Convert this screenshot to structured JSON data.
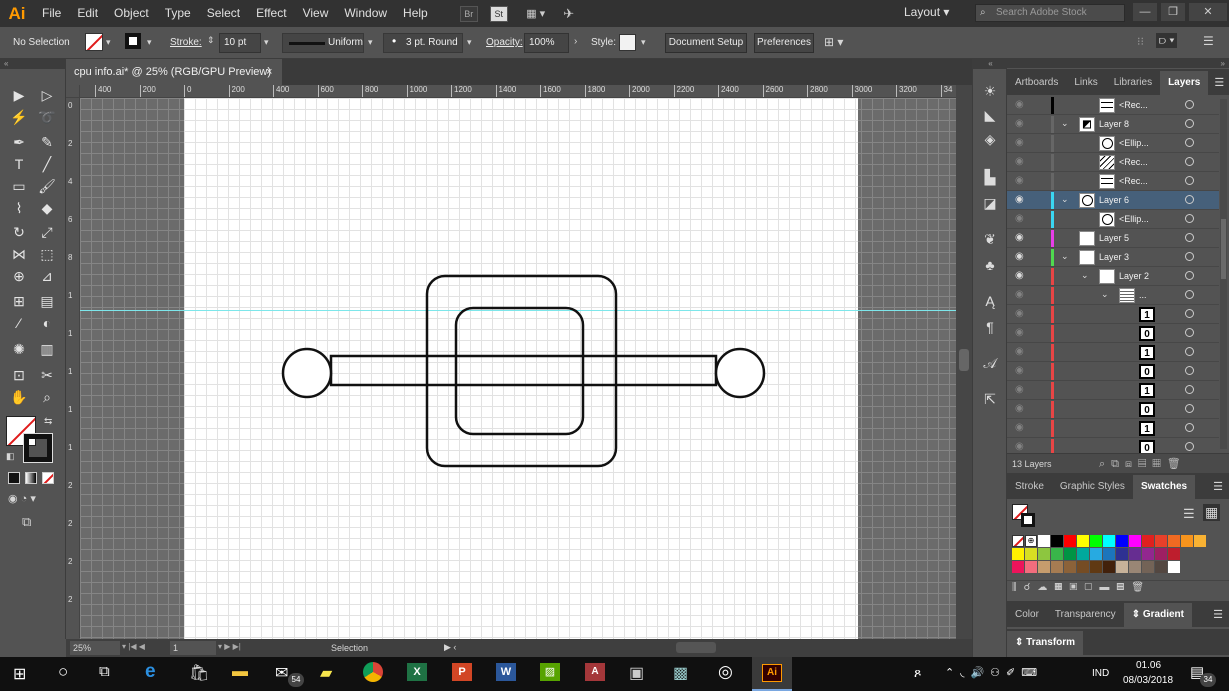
{
  "app": {
    "logo": "Ai"
  },
  "menu": [
    "File",
    "Edit",
    "Object",
    "Type",
    "Select",
    "Effect",
    "View",
    "Window",
    "Help"
  ],
  "menubar_extras": {
    "br": "Br",
    "st": "St"
  },
  "workspace": {
    "label": "Layout"
  },
  "search": {
    "placeholder": "Search Adobe Stock"
  },
  "control": {
    "selection": "No Selection",
    "stroke_label": "Stroke:",
    "stroke_value": "10 pt",
    "profile_label": "Uniform",
    "brush_label": "3 pt. Round",
    "opacity_label": "Opacity:",
    "opacity_value": "100%",
    "style_label": "Style:",
    "document_setup": "Document Setup",
    "preferences": "Preferences"
  },
  "document": {
    "tab_title": "cpu info.ai* @ 25% (RGB/GPU Preview)",
    "close": "×"
  },
  "ruler_top_ticks": [
    "400",
    "200",
    "0",
    "200",
    "400",
    "600",
    "800",
    "1000",
    "1200",
    "1400",
    "1600",
    "1800",
    "2000",
    "2200",
    "2400",
    "2600",
    "2800",
    "3000",
    "3200",
    "34"
  ],
  "ruler_left_ticks": [
    "0",
    "2",
    "4",
    "6",
    "8",
    "1",
    "1",
    "1",
    "1",
    "1",
    "2",
    "2",
    "2",
    "2"
  ],
  "status": {
    "zoom": "25%",
    "page": "1",
    "tool": "Selection"
  },
  "layers_panel": {
    "tabs": [
      "Artboards",
      "Links",
      "Libraries",
      "Layers"
    ],
    "active_tab": "Layers",
    "rows": [
      {
        "name": "<Rec...",
        "indent": 2,
        "thumb": "rect",
        "color": "#000000",
        "eye": false
      },
      {
        "name": "Layer 8",
        "indent": 1,
        "thumb": "img",
        "color": "#666666",
        "eye": false,
        "expanded": true
      },
      {
        "name": "<Ellip...",
        "indent": 2,
        "thumb": "circle",
        "color": "#666666",
        "eye": false
      },
      {
        "name": "<Rec...",
        "indent": 2,
        "thumb": "hatch",
        "color": "#666666",
        "eye": false
      },
      {
        "name": "<Rec...",
        "indent": 2,
        "thumb": "rect",
        "color": "#666666",
        "eye": false
      },
      {
        "name": "Layer 6",
        "indent": 1,
        "thumb": "circle",
        "color": "#3ad6f2",
        "eye": true,
        "expanded": true,
        "selected": true
      },
      {
        "name": "<Ellip...",
        "indent": 2,
        "thumb": "circle",
        "color": "#3ad6f2",
        "eye": false
      },
      {
        "name": "Layer 5",
        "indent": 1,
        "thumb": "blank",
        "color": "#e83ee8",
        "eye": true
      },
      {
        "name": "Layer 3",
        "indent": 1,
        "thumb": "blank",
        "color": "#4fd94f",
        "eye": true,
        "expanded": true
      },
      {
        "name": "Layer 2",
        "indent": 2,
        "thumb": "blank",
        "color": "#e84545",
        "eye": true,
        "expanded": true
      },
      {
        "name": "...",
        "indent": 3,
        "thumb": "grid",
        "color": "#e84545",
        "eye": false,
        "expanded": true
      },
      {
        "name": "",
        "indent": 4,
        "thumb": "1",
        "color": "#e84545",
        "eye": false
      },
      {
        "name": "",
        "indent": 4,
        "thumb": "0",
        "color": "#e84545",
        "eye": false
      },
      {
        "name": "",
        "indent": 4,
        "thumb": "1",
        "color": "#e84545",
        "eye": false
      },
      {
        "name": "",
        "indent": 4,
        "thumb": "0",
        "color": "#e84545",
        "eye": false
      },
      {
        "name": "",
        "indent": 4,
        "thumb": "1",
        "color": "#e84545",
        "eye": false
      },
      {
        "name": "",
        "indent": 4,
        "thumb": "0",
        "color": "#e84545",
        "eye": false
      },
      {
        "name": "",
        "indent": 4,
        "thumb": "1",
        "color": "#e84545",
        "eye": false
      },
      {
        "name": "",
        "indent": 4,
        "thumb": "0",
        "color": "#e84545",
        "eye": false
      }
    ],
    "count_label": "13 Layers"
  },
  "swatches_panel": {
    "tabs": [
      "Stroke",
      "Graphic Styles",
      "Swatches"
    ],
    "active_tab": "Swatches",
    "rows": [
      [
        "#ffffff",
        "#000000",
        "#ff0000",
        "#ffff00",
        "#00ff00",
        "#00ffff",
        "#0000ff",
        "#ff00ff",
        "#e0201f",
        "#e8402a",
        "#f06a22",
        "#f7941d",
        "#f9b233"
      ],
      [
        "#fff200",
        "#d7df23",
        "#8dc63f",
        "#39b54a",
        "#009444",
        "#00a99d",
        "#27aae1",
        "#1c75bc",
        "#2e3192",
        "#662d91",
        "#92278f",
        "#9e1f63",
        "#be1e2d"
      ],
      [
        "#ed145b",
        "#f26d7d",
        "#c69c6d",
        "#a67c52",
        "#8c6239",
        "#754c24",
        "#603913",
        "#42210b",
        "#c7b299",
        "#998675",
        "#736357",
        "#534741",
        "#ffffff"
      ]
    ]
  },
  "color_panel": {
    "tabs": [
      "Color",
      "Transparency",
      "Gradient"
    ],
    "active_tab": "Gradient"
  },
  "transform_panel": {
    "title": "Transform"
  },
  "taskbar": {
    "time": "01.06",
    "date": "08/03/2018",
    "lang": "IND",
    "mail_badge": "54",
    "notif_badge": "34",
    "ai_label": "Ai"
  }
}
